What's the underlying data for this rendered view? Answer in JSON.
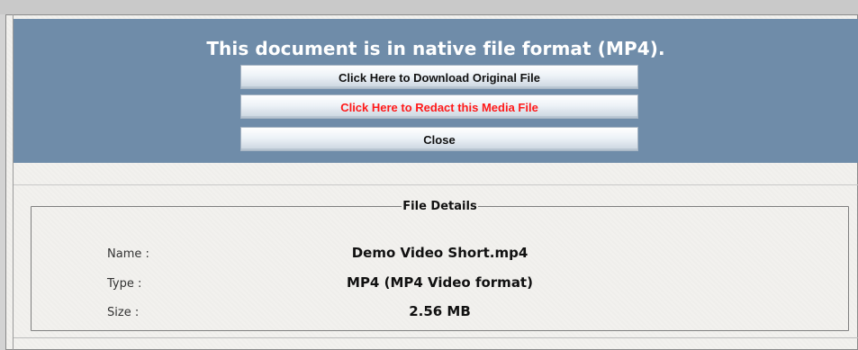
{
  "header": {
    "title": "This document is in native file format (MP4).",
    "buttons": {
      "download": "Click Here to Download Original File",
      "redact": "Click Here to Redact this Media File",
      "close": "Close"
    }
  },
  "file_details": {
    "legend": "File Details",
    "rows": [
      {
        "label": "Name :",
        "value": "Demo Video Short.mp4"
      },
      {
        "label": "Type :",
        "value": "MP4 (MP4 Video format)"
      },
      {
        "label": "Size :",
        "value": "2.56 MB"
      }
    ]
  },
  "colors": {
    "header_bg": "#6f8ca9",
    "redact_text": "#ff1a1a"
  }
}
